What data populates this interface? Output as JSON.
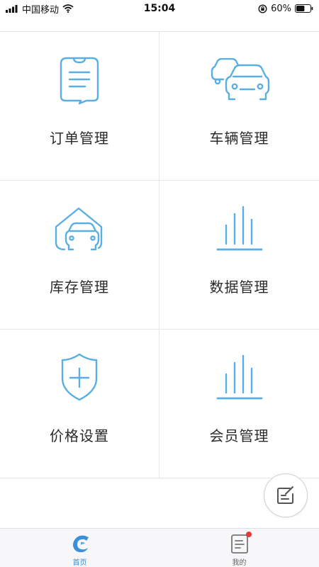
{
  "status_bar": {
    "carrier": "中国移动",
    "time": "15:04",
    "battery": "60%",
    "battery_level": 0.6
  },
  "menu": [
    {
      "label": "订单管理",
      "icon": "order-list-icon"
    },
    {
      "label": "车辆管理",
      "icon": "cars-icon"
    },
    {
      "label": "库存管理",
      "icon": "garage-icon"
    },
    {
      "label": "数据管理",
      "icon": "bar-stats-icon"
    },
    {
      "label": "价格设置",
      "icon": "shield-plus-icon"
    },
    {
      "label": "会员管理",
      "icon": "bar-stats-icon"
    }
  ],
  "fab": {
    "icon": "edit-note-icon"
  },
  "tabbar": {
    "tabs": [
      {
        "label": "首页",
        "icon": "dolphin-logo-icon",
        "active": true
      },
      {
        "label": "我的",
        "icon": "document-icon",
        "badge": true
      }
    ]
  },
  "colors": {
    "icon_blue": "#5aaee4",
    "tab_active": "#3a8fd6",
    "badge_red": "#e8363d"
  }
}
